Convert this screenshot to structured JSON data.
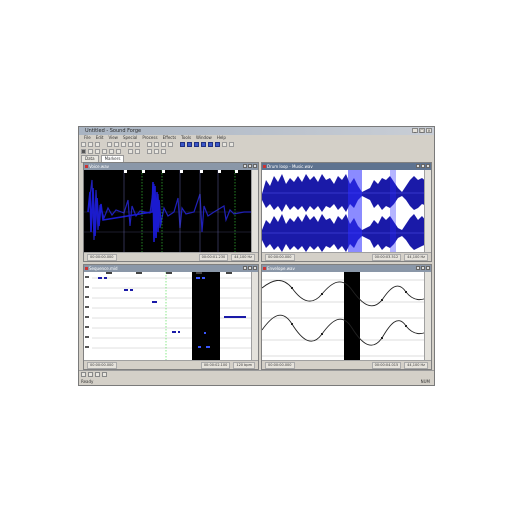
{
  "window": {
    "title": "Untitled - Sound Forge",
    "controls": [
      "_",
      "□",
      "×"
    ]
  },
  "menu": [
    "File",
    "Edit",
    "View",
    "Special",
    "Process",
    "Effects",
    "Tools",
    "Window",
    "Help"
  ],
  "tabs": [
    "Data",
    "Markers"
  ],
  "panes": [
    {
      "title": "Voice.wav",
      "status": [
        "00:00:00.000",
        "00:00:01.230",
        "44,100 Hz"
      ]
    },
    {
      "title": "Drum loop - Music.wav",
      "status": [
        "00:00:00.000",
        "00:00:03.512",
        "44,100 Hz"
      ]
    },
    {
      "title": "Sequence.mid",
      "status": [
        "00:00:00.000",
        "00:00:02.100",
        "120 bpm"
      ]
    },
    {
      "title": "Envelope.wav",
      "status": [
        "00:00:00.000",
        "00:00:04.015",
        "44,100 Hz"
      ]
    }
  ],
  "statusbar": {
    "left": "Ready",
    "right": "NUM"
  },
  "colors": {
    "waveform": "#1a1aa8",
    "waveform_highlight": "#2b2bff",
    "marker": "#3cdc3c",
    "pane_title_active": "#5e7390"
  }
}
